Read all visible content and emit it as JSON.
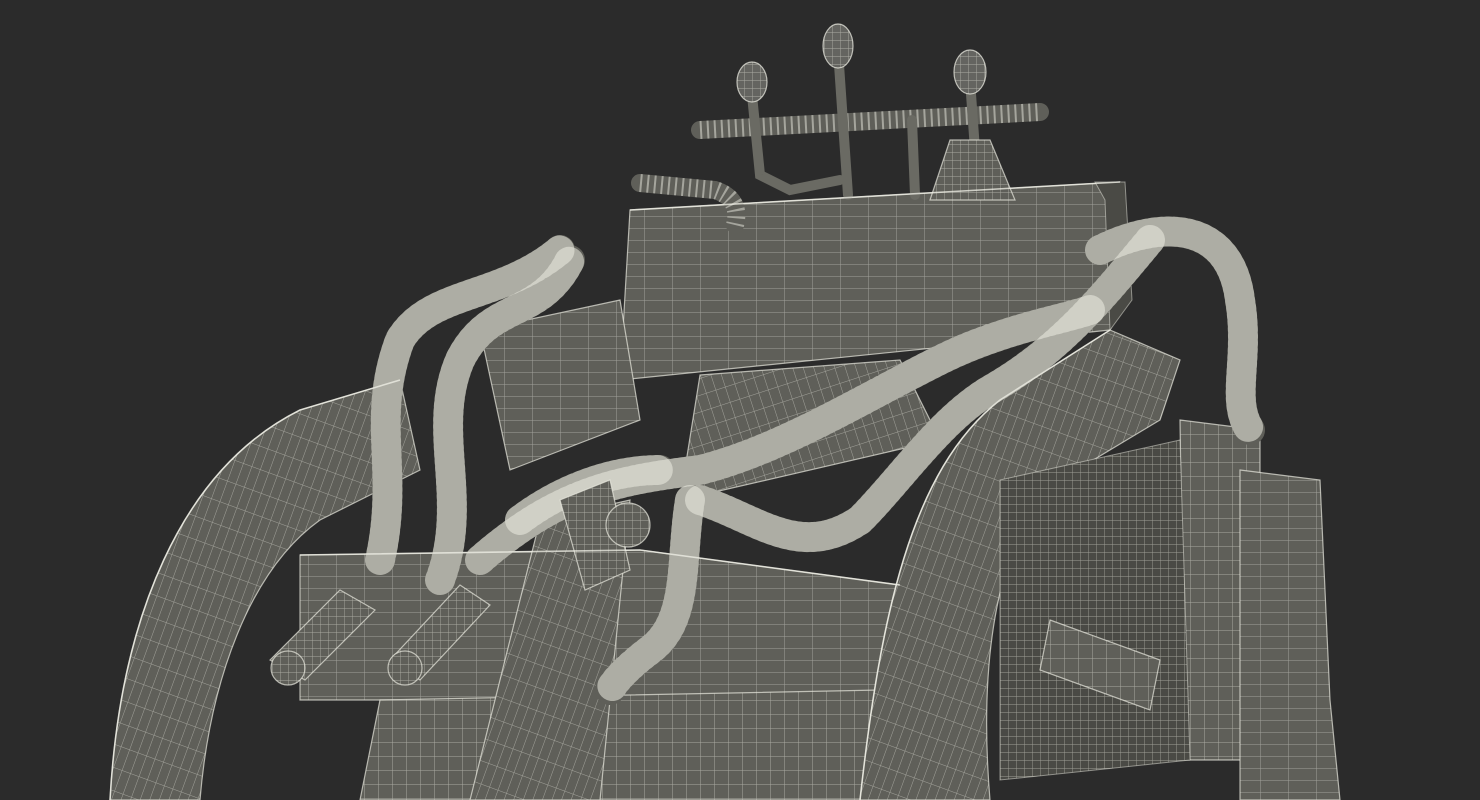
{
  "scene": {
    "subject": "wireframe-render",
    "background_color": "#2b2b2b",
    "surface_color": "#5f5f59",
    "surface_dark_color": "#4a4a45",
    "wire_color": "#e6e6dc",
    "wire_opacity": 0.55
  }
}
